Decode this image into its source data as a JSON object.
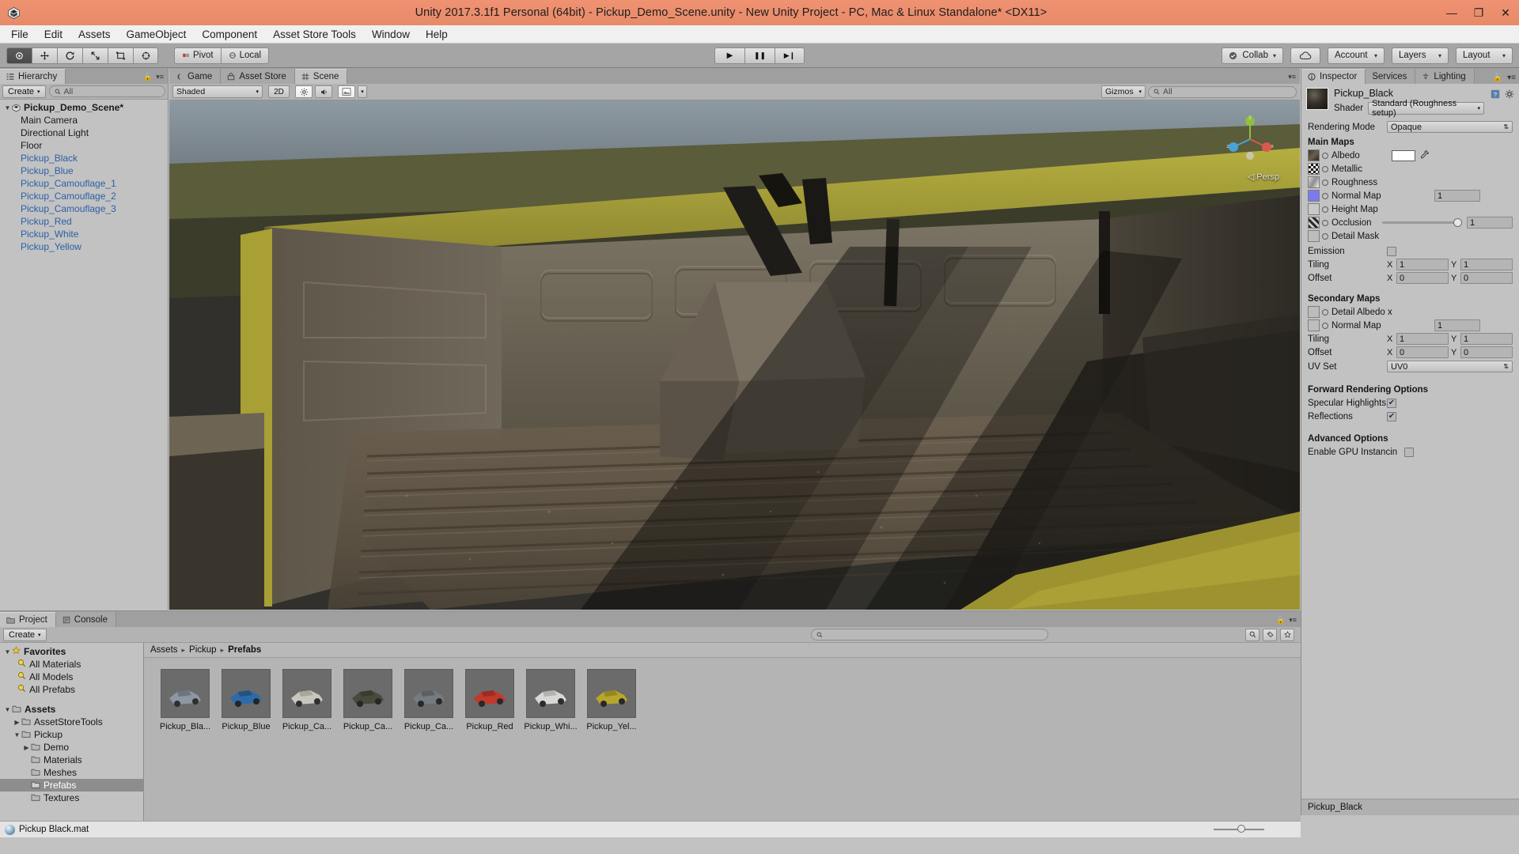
{
  "window": {
    "title": "Unity 2017.3.1f1 Personal (64bit) - Pickup_Demo_Scene.unity - New Unity Project - PC, Mac & Linux Standalone* <DX11>",
    "minimize": "—",
    "maximize": "❐",
    "close": "✕",
    "logo_icon": "unity-logo-icon"
  },
  "menubar": {
    "items": [
      "File",
      "Edit",
      "Assets",
      "GameObject",
      "Component",
      "Asset Store Tools",
      "Window",
      "Help"
    ]
  },
  "toolbar": {
    "tools": [
      {
        "name": "hand-tool",
        "glyph": "✋",
        "active": true
      },
      {
        "name": "move-tool",
        "glyph": "✛",
        "active": false
      },
      {
        "name": "rotate-tool",
        "glyph": "⟳",
        "active": false
      },
      {
        "name": "scale-tool",
        "glyph": "⤢",
        "active": false
      },
      {
        "name": "rect-tool",
        "glyph": "▣",
        "active": false
      },
      {
        "name": "transform-tool",
        "glyph": "✥",
        "active": false
      }
    ],
    "pivot_label": "Pivot",
    "local_label": "Local",
    "play_glyph": "▶",
    "pause_glyph": "❚❚",
    "step_glyph": "▶❙",
    "collab_label": "Collab",
    "cloud_icon": "cloud-icon",
    "account_label": "Account",
    "layers_label": "Layers",
    "layout_label": "Layout",
    "caret": "▾"
  },
  "hierarchy": {
    "tab_label": "Hierarchy",
    "tab_icon": "hierarchy-icon",
    "create_label": "Create",
    "create_caret": "▾",
    "search_placeholder": "All",
    "search_icon": "search-icon",
    "scene_name": "Pickup_Demo_Scene*",
    "items": [
      {
        "label": "Main Camera",
        "prefab": false
      },
      {
        "label": "Directional Light",
        "prefab": false
      },
      {
        "label": "Floor",
        "prefab": false
      },
      {
        "label": "Pickup_Black",
        "prefab": true
      },
      {
        "label": "Pickup_Blue",
        "prefab": true
      },
      {
        "label": "Pickup_Camouflage_1",
        "prefab": true
      },
      {
        "label": "Pickup_Camouflage_2",
        "prefab": true
      },
      {
        "label": "Pickup_Camouflage_3",
        "prefab": true
      },
      {
        "label": "Pickup_Red",
        "prefab": true
      },
      {
        "label": "Pickup_White",
        "prefab": true
      },
      {
        "label": "Pickup_Yellow",
        "prefab": true
      }
    ]
  },
  "sceneview": {
    "tabs": [
      {
        "label": "Game",
        "icon": "game-icon",
        "active": false
      },
      {
        "label": "Asset Store",
        "icon": "store-icon",
        "active": false
      },
      {
        "label": "Scene",
        "icon": "scene-grid-icon",
        "active": true
      }
    ],
    "draw_mode": "Shaded",
    "draw_mode_caret": "▾",
    "two_d_label": "2D",
    "lighting_icon": "sun-icon",
    "audio_icon": "speaker-icon",
    "effects_icon": "image-icon",
    "effects_caret": "▾",
    "gizmos_label": "Gizmos",
    "gizmos_caret": "▾",
    "search_placeholder": "All",
    "search_icon": "search-icon",
    "perspective_label": "Persp",
    "axis_x": "x",
    "axis_y": "y",
    "axis_z": "z"
  },
  "inspector": {
    "tabs": [
      {
        "label": "Inspector",
        "icon": "inspector-icon",
        "active": true
      },
      {
        "label": "Services",
        "icon": "services-icon",
        "active": false
      },
      {
        "label": "Lighting",
        "icon": "lighting-icon",
        "active": false
      }
    ],
    "lock_icon": "lock-icon",
    "menu_icon": "hamburger-icon",
    "material_name": "Pickup_Black",
    "help_icon": "help-icon",
    "gear_icon": "gear-icon",
    "shader_label": "Shader",
    "shader_value": "Standard (Roughness setup)",
    "rendering_mode_label": "Rendering Mode",
    "rendering_mode_value": "Opaque",
    "main_maps_label": "Main Maps",
    "maps": [
      {
        "label": "Albedo",
        "swatch": "#ffffff",
        "value": "",
        "has_color": true,
        "has_value": false,
        "has_slider": false
      },
      {
        "label": "Metallic",
        "value": "",
        "has_color": false,
        "has_value": false,
        "has_slider": false
      },
      {
        "label": "Roughness",
        "value": "",
        "has_color": false,
        "has_value": false,
        "has_slider": false
      },
      {
        "label": "Normal Map",
        "value": "1",
        "has_color": false,
        "has_value": true,
        "has_slider": false
      },
      {
        "label": "Height Map",
        "value": "",
        "has_color": false,
        "has_value": false,
        "has_slider": false
      },
      {
        "label": "Occlusion",
        "value": "1",
        "has_color": false,
        "has_value": true,
        "has_slider": true
      },
      {
        "label": "Detail Mask",
        "value": "",
        "has_color": false,
        "has_value": false,
        "has_slider": false
      }
    ],
    "emission_label": "Emission",
    "emission_checked": false,
    "tiling_label": "Tiling",
    "offset_label": "Offset",
    "main_tiling": {
      "x": "1",
      "y": "1"
    },
    "main_offset": {
      "x": "0",
      "y": "0"
    },
    "axis_x": "X",
    "axis_y": "Y",
    "secondary_maps_label": "Secondary Maps",
    "detail_albedo_label": "Detail Albedo x",
    "secondary_normal_label": "Normal Map",
    "secondary_normal_value": "1",
    "secondary_tiling": {
      "x": "1",
      "y": "1"
    },
    "secondary_offset": {
      "x": "0",
      "y": "0"
    },
    "uv_set_label": "UV Set",
    "uv_set_value": "UV0",
    "forward_label": "Forward Rendering Options",
    "specular_label": "Specular Highlights",
    "specular_checked": true,
    "reflections_label": "Reflections",
    "reflections_checked": true,
    "advanced_label": "Advanced Options",
    "gpu_instancing_label": "Enable GPU Instancin",
    "gpu_instancing_checked": false,
    "footer_label": "Pickup_Black"
  },
  "project": {
    "tabs": [
      {
        "label": "Project",
        "icon": "folder-icon",
        "active": true
      },
      {
        "label": "Console",
        "icon": "console-icon",
        "active": false
      }
    ],
    "create_label": "Create",
    "create_caret": "▾",
    "search_icon": "search-icon",
    "search_placeholder": "",
    "tree": [
      {
        "label": "Favorites",
        "depth": 0,
        "tri": "▼",
        "icon": "star-icon",
        "bold": true,
        "selected": false
      },
      {
        "label": "All Materials",
        "depth": 1,
        "tri": "",
        "icon": "search-saved-icon",
        "bold": false,
        "selected": false
      },
      {
        "label": "All Models",
        "depth": 1,
        "tri": "",
        "icon": "search-saved-icon",
        "bold": false,
        "selected": false
      },
      {
        "label": "All Prefabs",
        "depth": 1,
        "tri": "",
        "icon": "search-saved-icon",
        "bold": false,
        "selected": false
      },
      {
        "label": "",
        "depth": 0,
        "tri": "",
        "icon": "",
        "bold": false,
        "selected": false,
        "spacer": true
      },
      {
        "label": "Assets",
        "depth": 0,
        "tri": "▼",
        "icon": "folder-icon",
        "bold": true,
        "selected": false
      },
      {
        "label": "AssetStoreTools",
        "depth": 1,
        "tri": "▶",
        "icon": "folder-icon",
        "bold": false,
        "selected": false
      },
      {
        "label": "Pickup",
        "depth": 1,
        "tri": "▼",
        "icon": "folder-icon",
        "bold": false,
        "selected": false
      },
      {
        "label": "Demo",
        "depth": 2,
        "tri": "▶",
        "icon": "folder-icon",
        "bold": false,
        "selected": false
      },
      {
        "label": "Materials",
        "depth": 2,
        "tri": "",
        "icon": "folder-icon",
        "bold": false,
        "selected": false
      },
      {
        "label": "Meshes",
        "depth": 2,
        "tri": "",
        "icon": "folder-icon",
        "bold": false,
        "selected": false
      },
      {
        "label": "Prefabs",
        "depth": 2,
        "tri": "",
        "icon": "folder-icon",
        "bold": false,
        "selected": true
      },
      {
        "label": "Textures",
        "depth": 2,
        "tri": "",
        "icon": "folder-icon",
        "bold": false,
        "selected": false
      }
    ],
    "breadcrumb": [
      "Assets",
      "Pickup",
      "Prefabs"
    ],
    "breadcrumb_sep": "▸",
    "assets": [
      {
        "label": "Pickup_Bla...",
        "body": "#8d96a3",
        "cab": "#6d7480",
        "wheel": "#2d2f33"
      },
      {
        "label": "Pickup_Blue",
        "body": "#2f6aa8",
        "cab": "#24527f",
        "wheel": "#22242a"
      },
      {
        "label": "Pickup_Ca...",
        "body": "#c9c7bd",
        "cab": "#a9a79c",
        "wheel": "#2d2f33"
      },
      {
        "label": "Pickup_Ca...",
        "body": "#4a4a3c",
        "cab": "#3a3a2e",
        "wheel": "#24262a"
      },
      {
        "label": "Pickup_Ca...",
        "body": "#767b80",
        "cab": "#5a5f65",
        "wheel": "#26282c"
      },
      {
        "label": "Pickup_Red",
        "body": "#c0392b",
        "cab": "#9c2b20",
        "wheel": "#26282c"
      },
      {
        "label": "Pickup_Whi...",
        "body": "#d8d8d4",
        "cab": "#b3b3ae",
        "wheel": "#2a2c30"
      },
      {
        "label": "Pickup_Yel...",
        "body": "#b6a62b",
        "cab": "#958821",
        "wheel": "#26282c"
      }
    ],
    "status_item": "Pickup  Black.mat",
    "status_icon": "material-ball-icon",
    "filter_icons": [
      "search-filter-icon",
      "label-icon",
      "favorite-icon"
    ]
  }
}
